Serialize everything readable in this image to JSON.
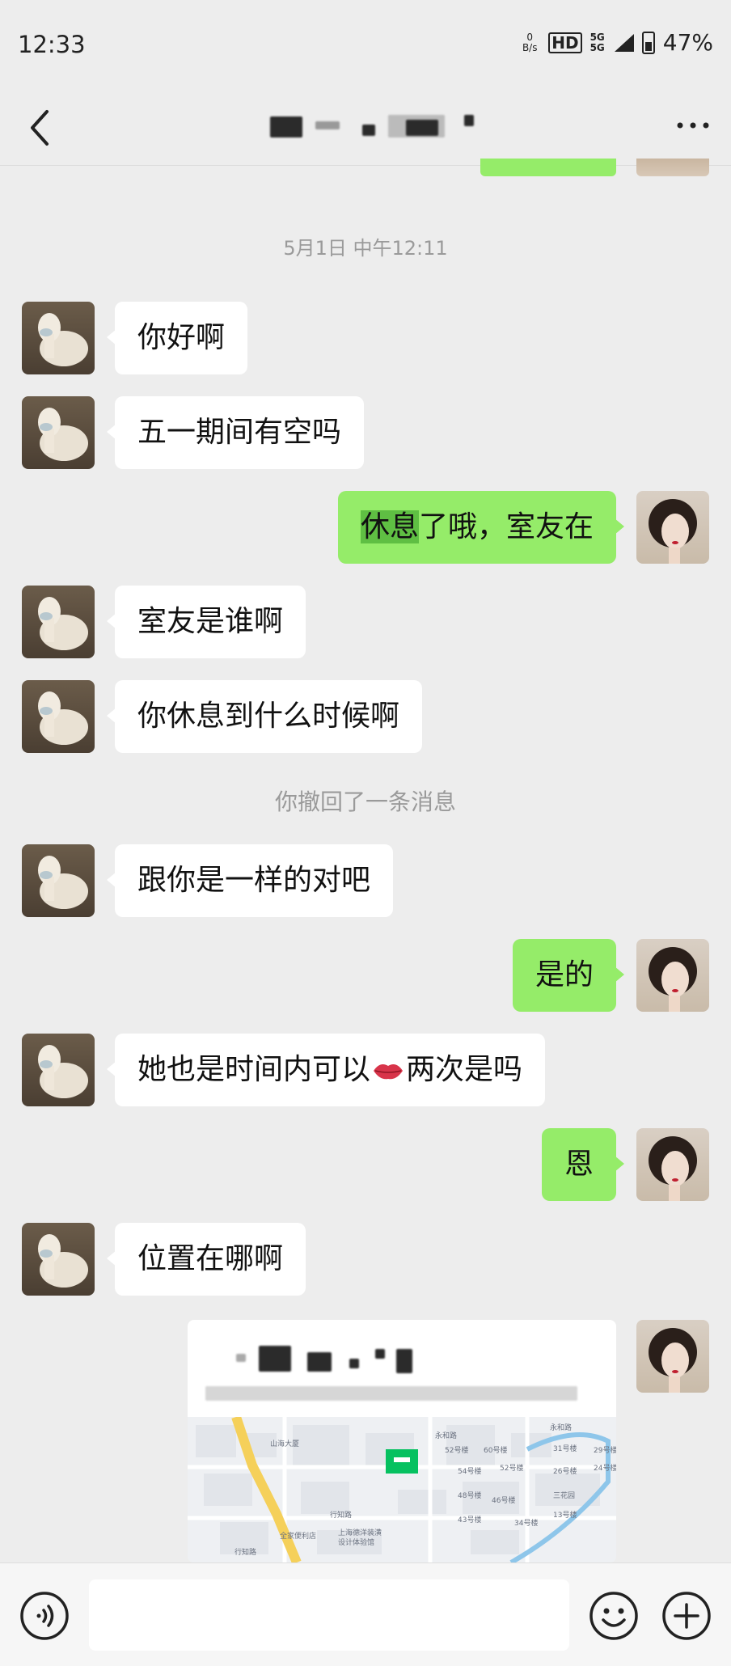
{
  "status_bar": {
    "time": "12:33",
    "net_speed_value": "0",
    "net_speed_unit": "B/s",
    "hd_label": "HD",
    "network_label_top": "5G",
    "network_label_bottom": "5G",
    "battery": "47%"
  },
  "nav": {
    "back_icon": "chevron-left-icon",
    "more_icon": "more-dots-icon"
  },
  "messages": {
    "timestamp": "5月1日 中午12:11",
    "m1": "你好啊",
    "m2": "五一期间有空吗",
    "m3_highlight": "休息",
    "m3_rest": "了哦，室友在",
    "m4": "室友是谁啊",
    "m5": "你休息到什么时候啊",
    "system_recall": "你撤回了一条消息",
    "m6": "跟你是一样的对吧",
    "m7": "是的",
    "m8_before": "她也是时间内可以",
    "m8_emoji": "lips-icon",
    "m8_after": "两次是吗",
    "m9": "恩",
    "m10": "位置在哪啊"
  },
  "location_card": {
    "map_labels": [
      "山海大厦",
      "永和路",
      "永和路",
      "52号楼",
      "60号楼",
      "31号楼",
      "29号楼",
      "54号楼",
      "52号楼",
      "26号楼",
      "24号楼",
      "48号楼",
      "46号楼",
      "三花园",
      "43号楼",
      "34号楼",
      "13号楼",
      "行知路",
      "上海德洋装潢",
      "设计体验馆",
      "全家便利店",
      "行知路"
    ]
  },
  "input_bar": {
    "placeholder": ""
  },
  "colors": {
    "background": "#ededed",
    "sent_bubble": "#95ec69",
    "received_bubble": "#ffffff"
  }
}
